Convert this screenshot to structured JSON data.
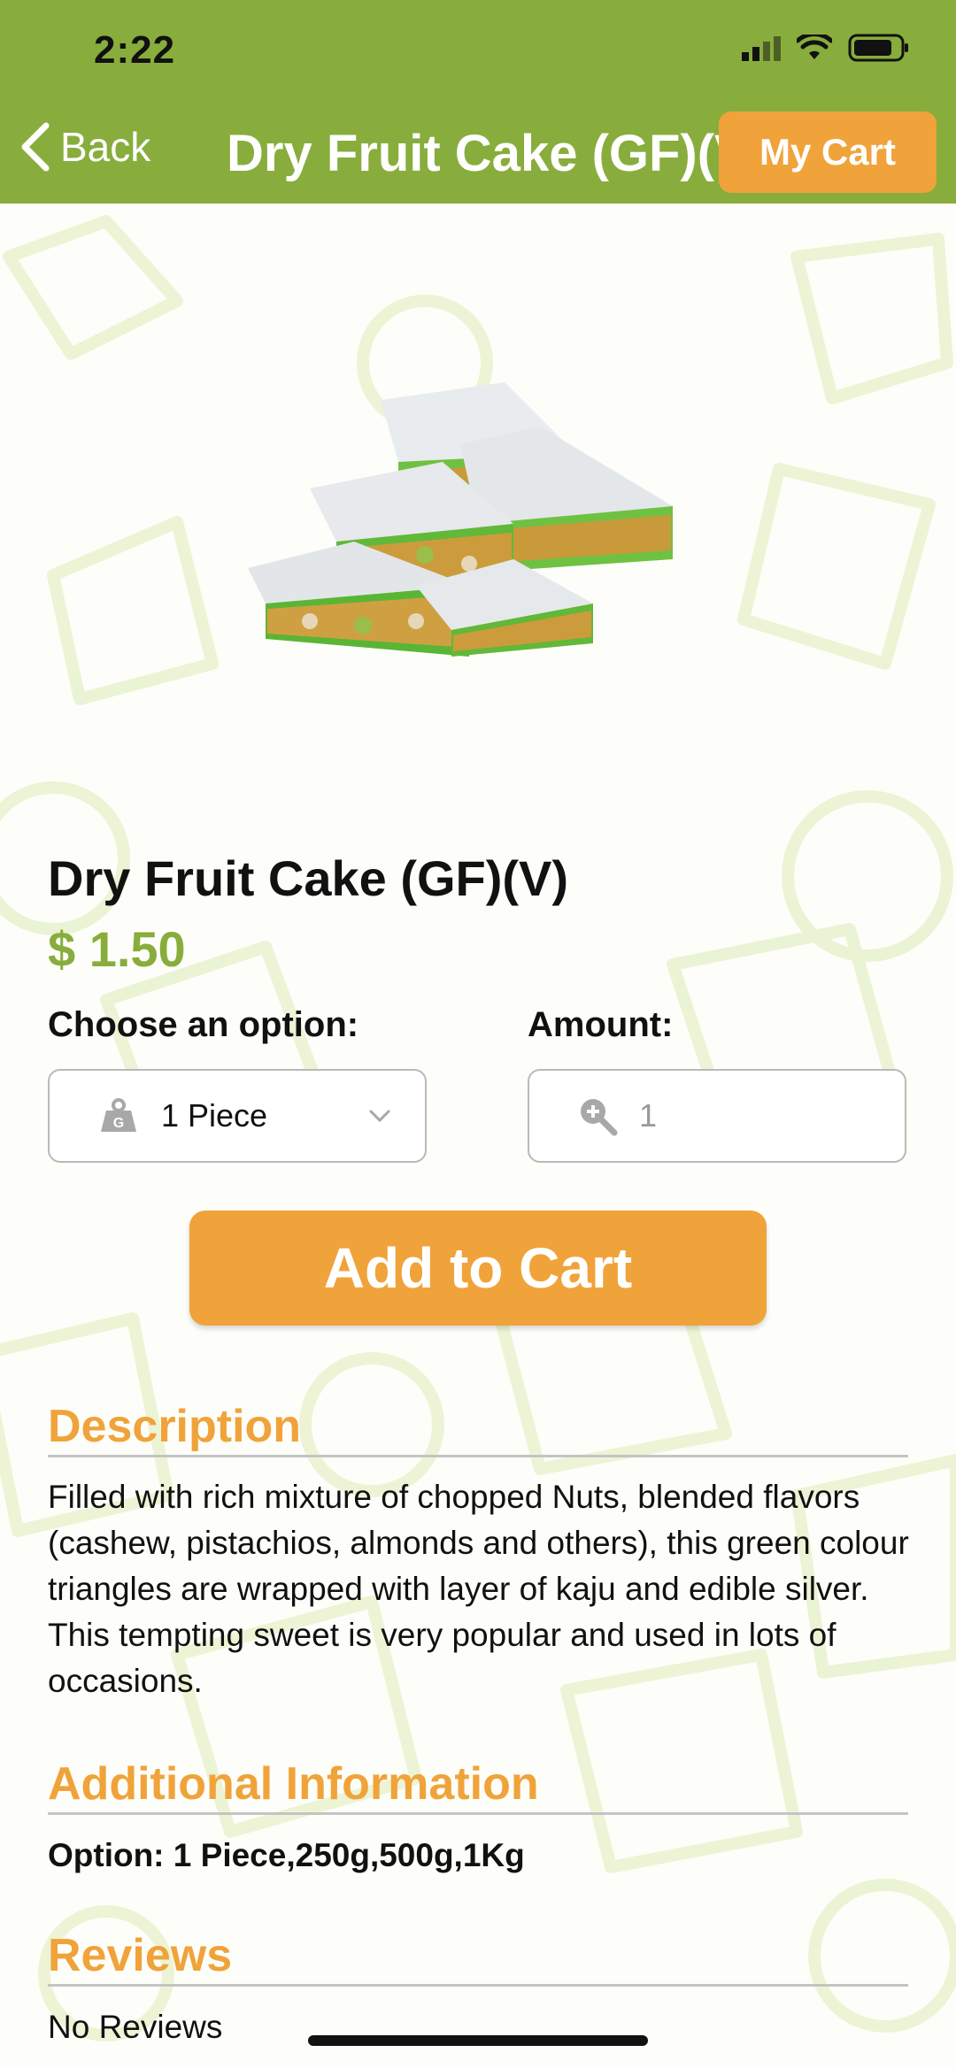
{
  "status_bar": {
    "time": "2:22"
  },
  "nav": {
    "back_label": "Back",
    "title": "Dry Fruit Cake (GF)(V)",
    "cart_label": "My Cart"
  },
  "product": {
    "name": "Dry Fruit Cake (GF)(V)",
    "price": "$ 1.50",
    "option_label": "Choose an option:",
    "option_value": "1 Piece",
    "amount_label": "Amount:",
    "amount_placeholder": "1",
    "add_to_cart_label": "Add to Cart"
  },
  "description": {
    "title": "Description",
    "text": "Filled with rich mixture of chopped Nuts, blended flavors (cashew, pistachios, almonds and others), this green colour triangles are wrapped with layer of kaju and edible silver. This tempting sweet is very popular and used in lots of occasions."
  },
  "additional_info": {
    "title": "Additional Information",
    "text": "Option: 1 Piece,250g,500g,1Kg"
  },
  "reviews": {
    "title": "Reviews",
    "text": "No Reviews"
  },
  "colors": {
    "header_green": "#88ad3c",
    "accent_orange": "#f0a33a",
    "price_green": "#88ad3c"
  },
  "icons": [
    "chevron-left-icon",
    "weight-icon",
    "chevron-down-icon",
    "zoom-plus-icon",
    "signal-icon",
    "wifi-icon",
    "battery-icon"
  ]
}
